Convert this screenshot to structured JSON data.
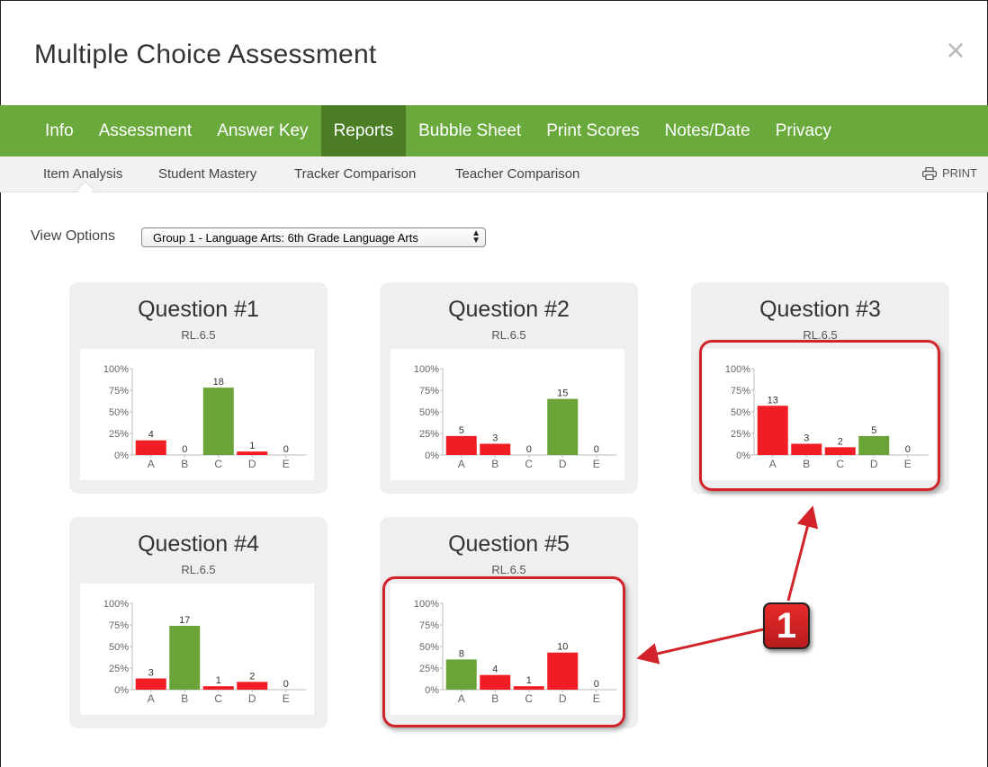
{
  "modal": {
    "title": "Multiple Choice Assessment",
    "close_icon": "close-icon"
  },
  "nav": {
    "items": [
      "Info",
      "Assessment",
      "Answer Key",
      "Reports",
      "Bubble Sheet",
      "Print Scores",
      "Notes/Date",
      "Privacy"
    ],
    "active": "Reports"
  },
  "subnav": {
    "items": [
      "Item Analysis",
      "Student Mastery",
      "Tracker Comparison",
      "Teacher Comparison"
    ],
    "active": "Item Analysis",
    "print_label": "PRINT",
    "print_icon": "printer-icon"
  },
  "view_options": {
    "label": "View Options",
    "selected": "Group 1 - Language Arts: 6th Grade Language Arts"
  },
  "colors": {
    "correct": "#6aa337",
    "incorrect": "#f01d25",
    "nav": "#6aa93c",
    "nav_active": "#4a7d24",
    "callout": "#d2232a"
  },
  "callout": {
    "label": "1"
  },
  "chart_data": [
    {
      "type": "bar",
      "title": "Question #1",
      "subtitle": "RL.6.5",
      "categories": [
        "A",
        "B",
        "C",
        "D",
        "E"
      ],
      "counts": [
        4,
        0,
        18,
        1,
        0
      ],
      "percents": [
        17,
        0,
        78,
        4,
        0
      ],
      "correct": "C",
      "yticks": [
        "100%",
        "75%",
        "50%",
        "25%",
        "0%"
      ],
      "ylim": [
        0,
        100
      ]
    },
    {
      "type": "bar",
      "title": "Question #2",
      "subtitle": "RL.6.5",
      "categories": [
        "A",
        "B",
        "C",
        "D",
        "E"
      ],
      "counts": [
        5,
        3,
        0,
        15,
        0
      ],
      "percents": [
        22,
        13,
        0,
        65,
        0
      ],
      "correct": "D",
      "yticks": [
        "100%",
        "75%",
        "50%",
        "25%",
        "0%"
      ],
      "ylim": [
        0,
        100
      ]
    },
    {
      "type": "bar",
      "title": "Question #3",
      "subtitle": "RL.6.5",
      "categories": [
        "A",
        "B",
        "C",
        "D",
        "E"
      ],
      "counts": [
        13,
        3,
        2,
        5,
        0
      ],
      "percents": [
        57,
        13,
        9,
        22,
        0
      ],
      "correct": "D",
      "yticks": [
        "100%",
        "75%",
        "50%",
        "25%",
        "0%"
      ],
      "ylim": [
        0,
        100
      ]
    },
    {
      "type": "bar",
      "title": "Question #4",
      "subtitle": "RL.6.5",
      "categories": [
        "A",
        "B",
        "C",
        "D",
        "E"
      ],
      "counts": [
        3,
        17,
        1,
        2,
        0
      ],
      "percents": [
        13,
        74,
        4,
        9,
        0
      ],
      "correct": "B",
      "yticks": [
        "100%",
        "75%",
        "50%",
        "25%",
        "0%"
      ],
      "ylim": [
        0,
        100
      ]
    },
    {
      "type": "bar",
      "title": "Question #5",
      "subtitle": "RL.6.5",
      "categories": [
        "A",
        "B",
        "C",
        "D",
        "E"
      ],
      "counts": [
        8,
        4,
        1,
        10,
        0
      ],
      "percents": [
        35,
        17,
        4,
        43,
        0
      ],
      "correct": "A",
      "yticks": [
        "100%",
        "75%",
        "50%",
        "25%",
        "0%"
      ],
      "ylim": [
        0,
        100
      ]
    }
  ]
}
